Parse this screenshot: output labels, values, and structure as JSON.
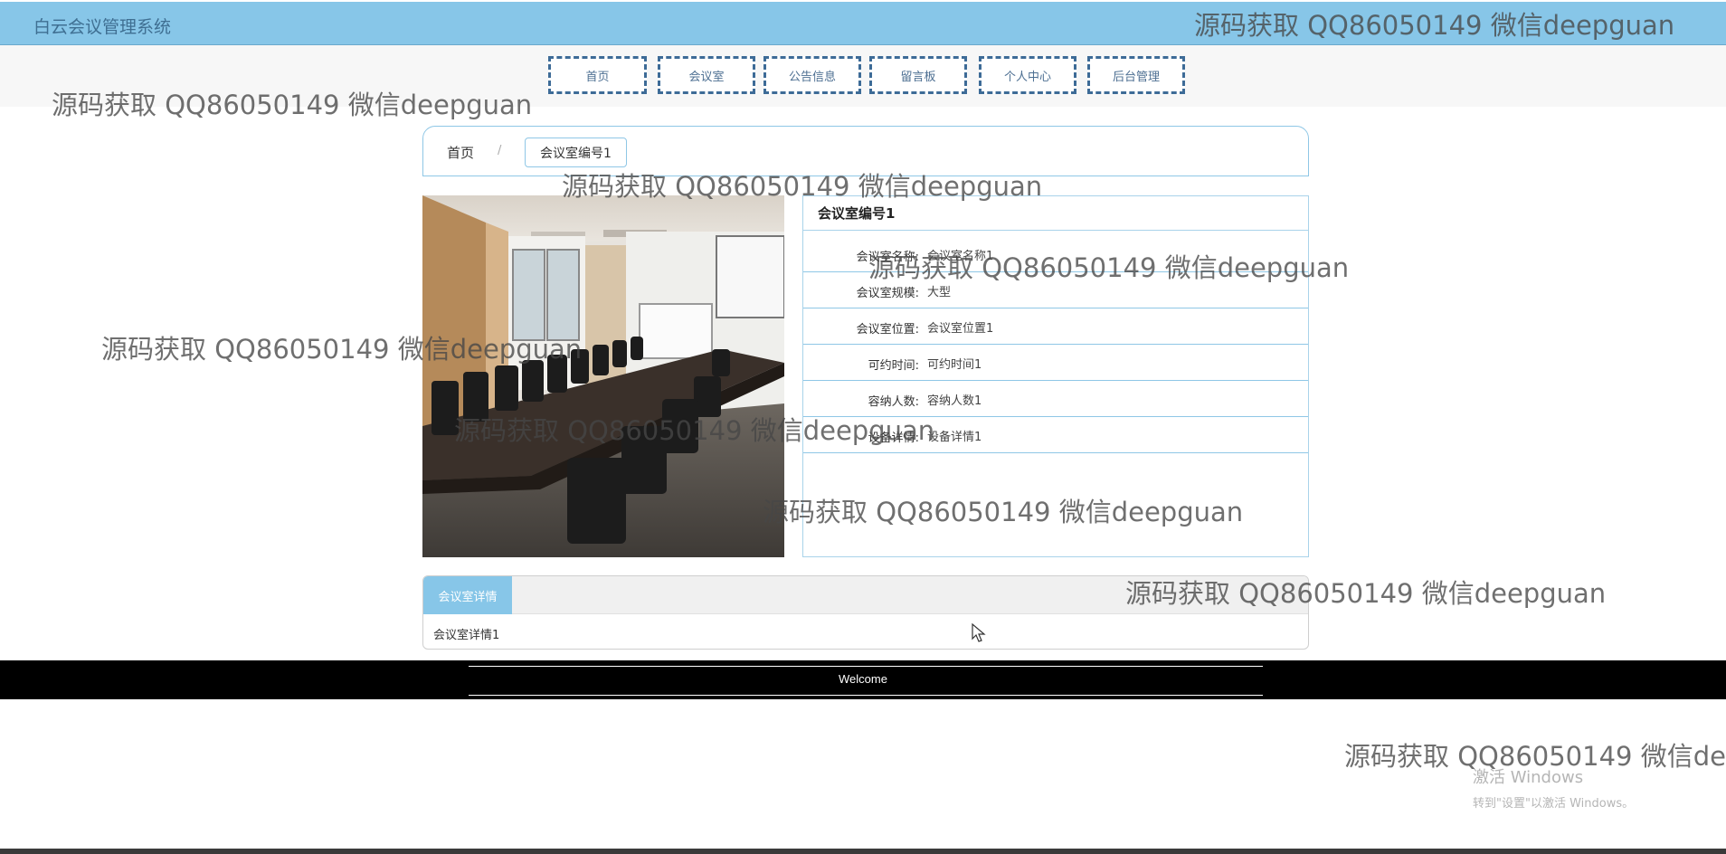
{
  "app": {
    "title": "白云会议管理系统"
  },
  "nav": [
    "首页",
    "会议室",
    "公告信息",
    "留言板",
    "个人中心",
    "后台管理"
  ],
  "breadcrumb": {
    "home": "首页",
    "separator": "/",
    "current": "会议室编号1"
  },
  "room": {
    "title": "会议室编号1",
    "fields": [
      {
        "label": "会议室名称:",
        "value": "会议室名称1"
      },
      {
        "label": "会议室规模:",
        "value": "大型"
      },
      {
        "label": "会议室位置:",
        "value": "会议室位置1"
      },
      {
        "label": "可约时间:",
        "value": "可约时间1"
      },
      {
        "label": "容纳人数:",
        "value": "容纳人数1"
      },
      {
        "label": "设备详情:",
        "value": "设备详情1"
      }
    ]
  },
  "detail": {
    "tab_label": "会议室详情",
    "content": "会议室详情1"
  },
  "footer": {
    "text": "Welcome"
  },
  "watermark": {
    "text": "源码获取 QQ86050149 微信deepguan"
  },
  "os_activation": {
    "line1": "激活 Windows",
    "line2": "转到\"设置\"以激活 Windows。"
  },
  "colors": {
    "header": "#87c6e8",
    "border": "#8fc7e6",
    "nav_border": "#3d6b97",
    "footer": "#000000"
  }
}
